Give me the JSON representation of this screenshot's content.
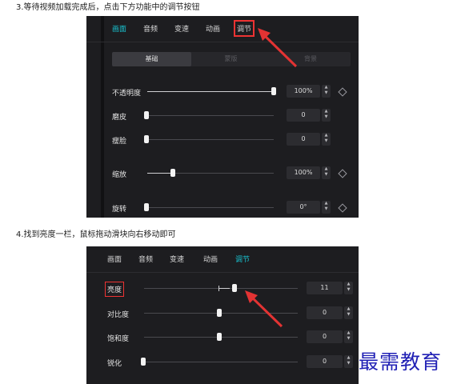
{
  "step1": "3.等待视频加载完成后，点击下方功能中的调节按钮",
  "step2": "4.找到亮度一栏，鼠标拖动滑块向右移动即可",
  "panel1": {
    "tabs": [
      "画面",
      "音频",
      "变速",
      "动画",
      "调节"
    ],
    "segments": [
      "基础",
      "蒙版",
      "背景"
    ],
    "rows": [
      {
        "label": "不透明度",
        "value": "100%",
        "level": 1.0
      },
      {
        "label": "磨皮",
        "value": "0",
        "level": 0.0
      },
      {
        "label": "瘦脸",
        "value": "0",
        "level": 0.0
      },
      {
        "label": "缩放",
        "value": "100%",
        "level": 0.2
      },
      {
        "label": "旋转",
        "value": "0°",
        "level": 0.0
      }
    ]
  },
  "panel2": {
    "tabs": [
      "画面",
      "音频",
      "变速",
      "动画",
      "调节"
    ],
    "rows": [
      {
        "label": "亮度",
        "value": "11",
        "level": 0.56
      },
      {
        "label": "对比度",
        "value": "0",
        "level": 0.5
      },
      {
        "label": "饱和度",
        "value": "0",
        "level": 0.5
      },
      {
        "label": "锐化",
        "value": "0",
        "level": 0.0
      }
    ]
  },
  "watermark": "最需教育",
  "colors": {
    "accent": "#19c3d0",
    "highlight": "#e33333",
    "panel_bg": "#1d1d20",
    "watermark": "#2121b5"
  },
  "icons": {
    "stepper": "up-down-stepper-icon",
    "keyframe": "diamond-keyframe-icon"
  }
}
